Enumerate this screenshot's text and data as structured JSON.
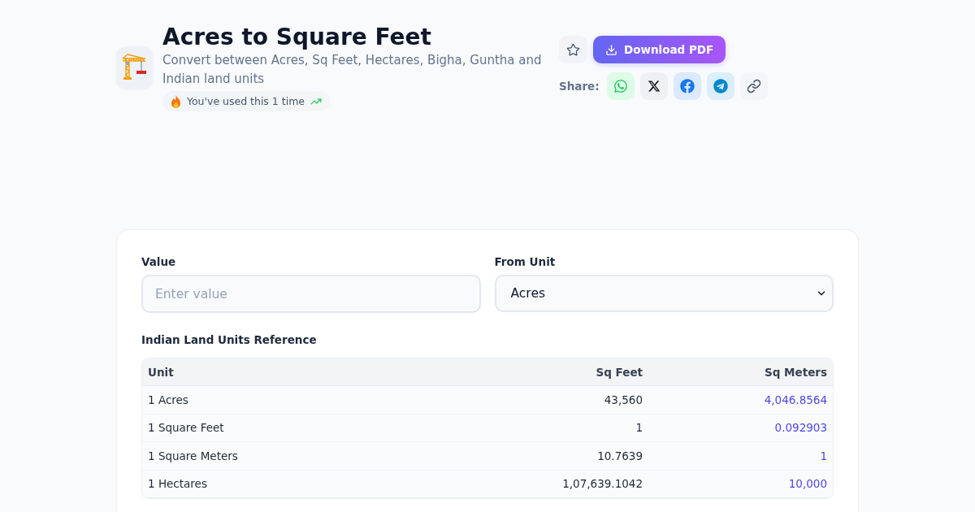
{
  "header": {
    "title": "Acres to Square Feet",
    "subtitle": "Convert between Acres, Sq Feet, Hectares, Bigha, Guntha and Indian land units",
    "usage_badge": "You've used this 1 time"
  },
  "actions": {
    "download_button": "Download PDF",
    "share_label": "Share:",
    "share_buttons": [
      {
        "kind": "whatsapp"
      },
      {
        "kind": "x"
      },
      {
        "kind": "facebook"
      },
      {
        "kind": "telegram"
      },
      {
        "kind": "link"
      }
    ]
  },
  "converter": {
    "value_field": {
      "label": "Value",
      "placeholder": "Enter value"
    },
    "unit_field": {
      "label": "From Unit",
      "value": "Acres"
    }
  },
  "reference": {
    "title": "Indian Land Units Reference",
    "columns": [
      "Unit",
      "Sq Feet",
      "Sq Meters"
    ],
    "rows": [
      [
        "1 Acres",
        "43,560",
        "4,046.8564"
      ],
      [
        "1 Square Feet",
        "1",
        "0.092903"
      ],
      [
        "1 Square Meters",
        "10.7639",
        "1"
      ],
      [
        "1 Hectares",
        "1,07,639.1042",
        "10,000"
      ]
    ]
  }
}
